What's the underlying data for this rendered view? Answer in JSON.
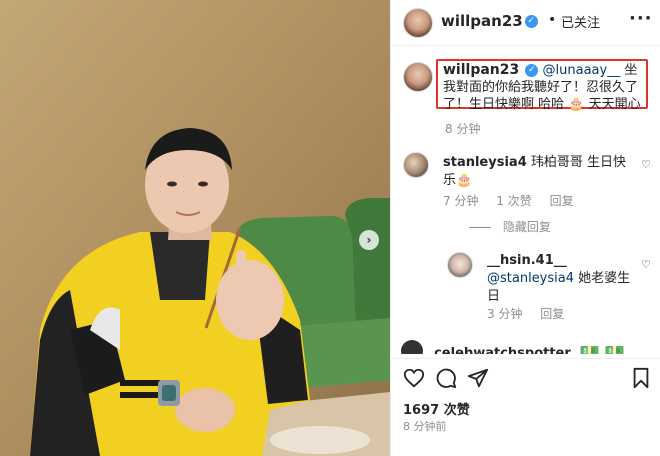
{
  "header": {
    "username": "willpan23",
    "separator": "•",
    "follow_label": "已关注",
    "more_icon": "more-horizontal-icon"
  },
  "caption": {
    "username": "willpan23",
    "mention": "@lunaaay__",
    "text": " 坐我對面的你給我聽好了！忍很久了了！生日快樂啊 哈哈 🎂 天天開心",
    "time": "8 分钟"
  },
  "comments": [
    {
      "username": "stanleysia4",
      "text": "玮柏哥哥 生日快乐🎂",
      "time": "7 分钟",
      "likes": "1 次赞",
      "reply_label": "回复"
    },
    {
      "username": "__hsin.41__",
      "mention": "@stanleysia4",
      "text": " 她老婆生日",
      "time": "3 分钟",
      "reply_label": "回复"
    }
  ],
  "hidden_replies_label": "隐藏回复",
  "cutoff_comment": {
    "username": "celebwatchspotter",
    "emoji": "💵 💵"
  },
  "actions": {
    "like_icon": "heart-icon",
    "comment_icon": "comment-icon",
    "share_icon": "share-icon",
    "save_icon": "bookmark-icon"
  },
  "likes": "1697 次赞",
  "posted_time": "8 分钟前",
  "colors": {
    "highlight_border": "#e0342a",
    "mention": "#00376b",
    "verified": "#3897f0",
    "jacket_yellow": "#f4d21f"
  }
}
